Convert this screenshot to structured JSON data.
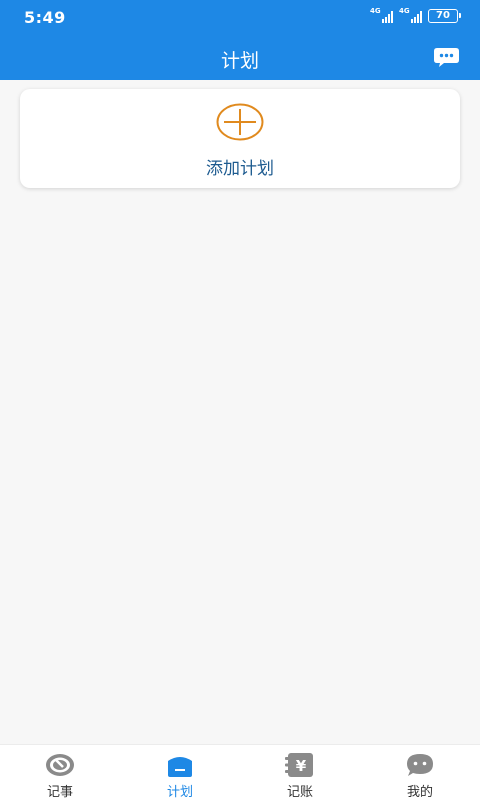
{
  "status_bar": {
    "time": "5:49",
    "network_1": "4G",
    "network_2": "4G",
    "battery": "70"
  },
  "header": {
    "title": "计划",
    "message_icon": "chat-bubble-icon"
  },
  "card": {
    "add_icon": "plus-circle-icon",
    "add_label": "添加计划"
  },
  "bottom_nav": {
    "active_index": 1,
    "items": [
      {
        "label": "记事",
        "icon": "notebook-icon"
      },
      {
        "label": "计划",
        "icon": "plan-icon"
      },
      {
        "label": "记账",
        "icon": "ledger-yen-icon"
      },
      {
        "label": "我的",
        "icon": "profile-face-icon"
      }
    ]
  },
  "colors": {
    "primary": "#1e88e5",
    "accent_orange": "#e08a1e",
    "label_blue": "#1c5a8f",
    "nav_gray": "#8a8a8a"
  }
}
